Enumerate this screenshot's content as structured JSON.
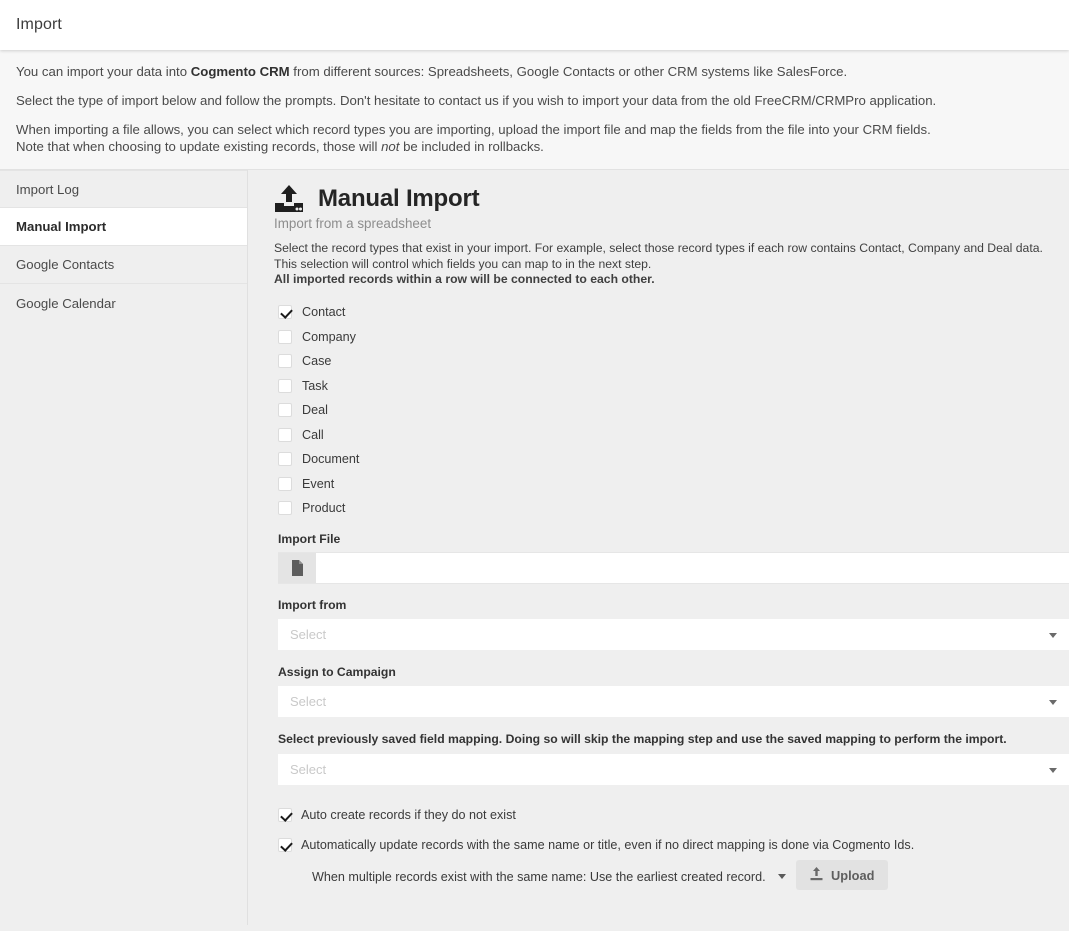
{
  "header": {
    "title": "Import"
  },
  "intro": {
    "line1_pre": "You can import your data into ",
    "line1_brand": "Cogmento CRM",
    "line1_post": " from different sources: Spreadsheets, Google Contacts or other CRM systems like SalesForce.",
    "line2": "Select the type of import below and follow the prompts. Don't hesitate to contact us if you wish to import your data from the old FreeCRM/CRMPro application.",
    "line3a": "When importing a file allows, you can select which record types you are importing, upload the import file and map the fields from the file into your CRM fields.",
    "line3b_pre": "Note that when choosing to update existing records, those will ",
    "line3b_em": "not",
    "line3b_post": " be included in rollbacks."
  },
  "sidebar": {
    "items": [
      {
        "label": "Import Log",
        "active": false
      },
      {
        "label": "Manual Import",
        "active": true
      },
      {
        "label": "Google Contacts",
        "active": false
      },
      {
        "label": "Google Calendar",
        "active": false
      }
    ]
  },
  "main": {
    "icon": "upload-icon",
    "title": "Manual Import",
    "subtitle": "Import from a spreadsheet",
    "desc_line1": "Select the record types that exist in your import. For example, select those record types if each row contains Contact, Company and Deal data.",
    "desc_line2": "This selection will control which fields you can map to in the next step.",
    "desc_line3_bold": "All imported records within a row will be connected to each other.",
    "record_types": [
      {
        "label": "Contact",
        "checked": true
      },
      {
        "label": "Company",
        "checked": false
      },
      {
        "label": "Case",
        "checked": false
      },
      {
        "label": "Task",
        "checked": false
      },
      {
        "label": "Deal",
        "checked": false
      },
      {
        "label": "Call",
        "checked": false
      },
      {
        "label": "Document",
        "checked": false
      },
      {
        "label": "Event",
        "checked": false
      },
      {
        "label": "Product",
        "checked": false
      }
    ],
    "import_file": {
      "label": "Import File",
      "button_icon": "document-icon",
      "value": "",
      "placeholder": ""
    },
    "import_from": {
      "label": "Import from",
      "value": "",
      "placeholder": "Select",
      "caret_icon": "chevron-down-icon"
    },
    "assign_campaign": {
      "label": "Assign to Campaign",
      "value": "",
      "placeholder": "Select",
      "caret_icon": "chevron-down-icon"
    },
    "saved_mapping": {
      "label": "Select previously saved field mapping. Doing so will skip the mapping step and use the saved mapping to perform the import.",
      "value": "",
      "placeholder": "Select",
      "caret_icon": "chevron-down-icon"
    },
    "auto_create": {
      "label": "Auto create records if they do not exist",
      "checked": true
    },
    "auto_update": {
      "label": "Automatically update records with the same name or title, even if no direct mapping is done via Cogmento Ids.",
      "checked": true
    },
    "duplicate_rule": {
      "label": "When multiple records exist with the same name: Use the earliest created record.",
      "caret_icon": "chevron-down-icon"
    },
    "upload_button": {
      "label": "Upload",
      "icon": "upload-icon"
    }
  },
  "colors": {
    "page_bg": "#efefef",
    "panel_white": "#ffffff",
    "intro_bg": "#f7f7f7",
    "text_primary": "#3a3a3a",
    "text_muted": "#8d8d8d",
    "button_bg": "#e2e2e2"
  }
}
